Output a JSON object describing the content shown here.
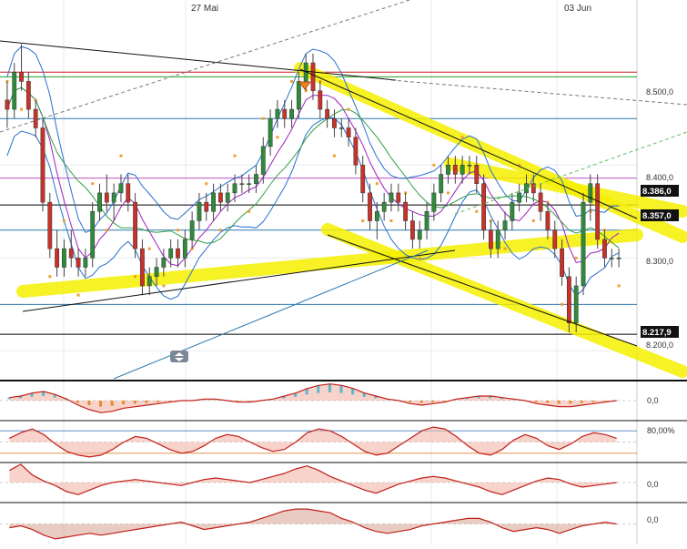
{
  "chart_data": {
    "type": "candlestick",
    "date_labels": [
      "27 Mai",
      "03 Jun"
    ],
    "price_axis": {
      "ylim": [
        8.17,
        8.56
      ],
      "ticks": [
        {
          "value": 8.5,
          "label": "8.500,0"
        },
        {
          "value": 8.4,
          "label": "8.400,0"
        },
        {
          "value": 8.3,
          "label": "8.300,0"
        },
        {
          "value": 8.2,
          "label": "8.200,0"
        }
      ]
    },
    "price_markers": [
      {
        "value": 8.386,
        "label": "8.386,0"
      },
      {
        "value": 8.357,
        "label": "8.357,0"
      },
      {
        "value": 8.2179,
        "label": "8.217,9"
      }
    ],
    "horizontal_levels": [
      {
        "value": 8.5,
        "color": "#d02020"
      },
      {
        "value": 8.495,
        "color": "#20a020"
      },
      {
        "value": 8.45,
        "color": "#2a7ab0"
      },
      {
        "value": 8.386,
        "color": "#c050c0"
      },
      {
        "value": 8.357,
        "color": "#000000"
      },
      {
        "value": 8.33,
        "color": "#2a7ab0"
      },
      {
        "value": 8.25,
        "color": "#2a7ab0"
      },
      {
        "value": 8.2179,
        "color": "#000000"
      }
    ],
    "candles": [
      [
        8.47,
        8.49,
        8.44,
        8.46
      ],
      [
        8.46,
        8.51,
        8.45,
        8.5
      ],
      [
        8.5,
        8.53,
        8.48,
        8.49
      ],
      [
        8.49,
        8.5,
        8.45,
        8.46
      ],
      [
        8.46,
        8.47,
        8.43,
        8.44
      ],
      [
        8.44,
        8.45,
        8.35,
        8.36
      ],
      [
        8.36,
        8.37,
        8.3,
        8.31
      ],
      [
        8.31,
        8.33,
        8.28,
        8.29
      ],
      [
        8.29,
        8.32,
        8.28,
        8.31
      ],
      [
        8.31,
        8.33,
        8.29,
        8.3
      ],
      [
        8.3,
        8.31,
        8.28,
        8.29
      ],
      [
        8.29,
        8.31,
        8.28,
        8.3
      ],
      [
        8.3,
        8.36,
        8.29,
        8.35
      ],
      [
        8.35,
        8.38,
        8.34,
        8.37
      ],
      [
        8.37,
        8.39,
        8.35,
        8.36
      ],
      [
        8.36,
        8.38,
        8.34,
        8.37
      ],
      [
        8.37,
        8.39,
        8.36,
        8.38
      ],
      [
        8.38,
        8.39,
        8.35,
        8.36
      ],
      [
        8.36,
        8.37,
        8.3,
        8.31
      ],
      [
        8.31,
        8.32,
        8.26,
        8.27
      ],
      [
        8.27,
        8.29,
        8.26,
        8.28
      ],
      [
        8.28,
        8.3,
        8.27,
        8.29
      ],
      [
        8.29,
        8.31,
        8.28,
        8.3
      ],
      [
        8.3,
        8.32,
        8.29,
        8.31
      ],
      [
        8.31,
        8.32,
        8.29,
        8.3
      ],
      [
        8.3,
        8.33,
        8.29,
        8.32
      ],
      [
        8.32,
        8.35,
        8.31,
        8.34
      ],
      [
        8.34,
        8.37,
        8.33,
        8.36
      ],
      [
        8.36,
        8.37,
        8.34,
        8.35
      ],
      [
        8.35,
        8.38,
        8.34,
        8.37
      ],
      [
        8.37,
        8.38,
        8.35,
        8.36
      ],
      [
        8.36,
        8.38,
        8.35,
        8.37
      ],
      [
        8.37,
        8.39,
        8.36,
        8.38
      ],
      [
        8.38,
        8.39,
        8.37,
        8.38
      ],
      [
        8.38,
        8.39,
        8.37,
        8.38
      ],
      [
        8.38,
        8.4,
        8.37,
        8.39
      ],
      [
        8.39,
        8.43,
        8.38,
        8.42
      ],
      [
        8.42,
        8.46,
        8.41,
        8.45
      ],
      [
        8.45,
        8.47,
        8.44,
        8.46
      ],
      [
        8.46,
        8.47,
        8.44,
        8.45
      ],
      [
        8.45,
        8.47,
        8.44,
        8.46
      ],
      [
        8.46,
        8.5,
        8.45,
        8.49
      ],
      [
        8.49,
        8.52,
        8.48,
        8.51
      ],
      [
        8.51,
        8.52,
        8.47,
        8.48
      ],
      [
        8.48,
        8.49,
        8.45,
        8.46
      ],
      [
        8.46,
        8.47,
        8.44,
        8.45
      ],
      [
        8.45,
        8.46,
        8.43,
        8.44
      ],
      [
        8.44,
        8.45,
        8.43,
        8.44
      ],
      [
        8.44,
        8.45,
        8.42,
        8.43
      ],
      [
        8.43,
        8.44,
        8.39,
        8.4
      ],
      [
        8.4,
        8.41,
        8.36,
        8.37
      ],
      [
        8.37,
        8.38,
        8.33,
        8.34
      ],
      [
        8.34,
        8.36,
        8.32,
        8.35
      ],
      [
        8.35,
        8.37,
        8.34,
        8.36
      ],
      [
        8.36,
        8.38,
        8.35,
        8.37
      ],
      [
        8.37,
        8.38,
        8.35,
        8.36
      ],
      [
        8.36,
        8.37,
        8.33,
        8.34
      ],
      [
        8.34,
        8.35,
        8.31,
        8.32
      ],
      [
        8.32,
        8.34,
        8.31,
        8.33
      ],
      [
        8.33,
        8.36,
        8.32,
        8.35
      ],
      [
        8.35,
        8.38,
        8.34,
        8.37
      ],
      [
        8.37,
        8.4,
        8.36,
        8.39
      ],
      [
        8.39,
        8.41,
        8.38,
        8.4
      ],
      [
        8.4,
        8.41,
        8.38,
        8.39
      ],
      [
        8.39,
        8.41,
        8.38,
        8.4
      ],
      [
        8.4,
        8.41,
        8.39,
        8.4
      ],
      [
        8.4,
        8.41,
        8.37,
        8.38
      ],
      [
        8.38,
        8.39,
        8.32,
        8.33
      ],
      [
        8.33,
        8.34,
        8.3,
        8.31
      ],
      [
        8.31,
        8.34,
        8.3,
        8.33
      ],
      [
        8.33,
        8.35,
        8.32,
        8.34
      ],
      [
        8.34,
        8.37,
        8.33,
        8.36
      ],
      [
        8.36,
        8.38,
        8.35,
        8.37
      ],
      [
        8.37,
        8.39,
        8.36,
        8.38
      ],
      [
        8.38,
        8.39,
        8.36,
        8.37
      ],
      [
        8.37,
        8.38,
        8.34,
        8.35
      ],
      [
        8.35,
        8.36,
        8.32,
        8.33
      ],
      [
        8.33,
        8.34,
        8.3,
        8.31
      ],
      [
        8.31,
        8.32,
        8.27,
        8.28
      ],
      [
        8.28,
        8.29,
        8.22,
        8.23
      ],
      [
        8.23,
        8.28,
        8.22,
        8.27
      ],
      [
        8.27,
        8.37,
        8.26,
        8.36
      ],
      [
        8.36,
        8.39,
        8.34,
        8.38
      ],
      [
        8.38,
        8.39,
        8.31,
        8.32
      ],
      [
        8.32,
        8.33,
        8.29,
        8.3
      ],
      [
        8.3,
        8.31,
        8.29,
        8.3
      ],
      [
        8.3,
        8.31,
        8.29,
        8.3
      ]
    ],
    "indicator_panels": [
      {
        "tick_label": "0,0",
        "values": [
          0.2,
          0.3,
          0.5,
          0.6,
          0.4,
          0.1,
          -0.3,
          -0.6,
          -0.8,
          -0.7,
          -0.5,
          -0.4,
          -0.3,
          -0.2,
          -0.1,
          0.0,
          0.0,
          0.1,
          0.1,
          0.0,
          -0.1,
          -0.1,
          0.0,
          0.1,
          0.3,
          0.5,
          0.8,
          1.0,
          1.1,
          1.0,
          0.8,
          0.5,
          0.3,
          0.1,
          0.0,
          -0.2,
          -0.3,
          -0.2,
          -0.1,
          0.1,
          0.2,
          0.3,
          0.3,
          0.2,
          0.1,
          0.0,
          -0.2,
          -0.3,
          -0.4,
          -0.4,
          -0.3,
          -0.2,
          -0.1,
          0.0
        ]
      },
      {
        "tick_label": "80,00%",
        "values": [
          60,
          75,
          85,
          70,
          45,
          25,
          15,
          10,
          15,
          30,
          50,
          65,
          60,
          45,
          30,
          20,
          25,
          40,
          60,
          70,
          65,
          50,
          35,
          25,
          30,
          50,
          75,
          85,
          80,
          65,
          45,
          25,
          15,
          20,
          40,
          60,
          80,
          90,
          85,
          65,
          40,
          20,
          15,
          30,
          55,
          70,
          60,
          40,
          30,
          45,
          65,
          75,
          70,
          60
        ]
      },
      {
        "tick_label": "0,0",
        "values": [
          0.8,
          1.2,
          0.5,
          0.1,
          -0.2,
          -0.6,
          -0.8,
          -0.5,
          -0.2,
          0.0,
          0.1,
          0.2,
          0.1,
          0.0,
          -0.1,
          -0.2,
          0.0,
          0.2,
          0.3,
          0.2,
          0.1,
          0.0,
          0.2,
          0.4,
          0.6,
          0.9,
          1.1,
          0.8,
          0.4,
          0.1,
          -0.2,
          -0.5,
          -0.7,
          -0.4,
          -0.1,
          0.1,
          0.3,
          0.4,
          0.3,
          0.1,
          -0.1,
          -0.3,
          -0.6,
          -0.8,
          -0.5,
          -0.2,
          0.1,
          0.3,
          0.2,
          -0.1,
          -0.3,
          -0.2,
          -0.1,
          0.0
        ]
      },
      {
        "tick_label": "0,0",
        "values": [
          -0.2,
          -0.1,
          -0.3,
          -0.6,
          -0.8,
          -0.7,
          -0.6,
          -0.5,
          -0.6,
          -0.5,
          -0.4,
          -0.3,
          -0.2,
          -0.1,
          0.0,
          0.1,
          -0.1,
          -0.3,
          -0.2,
          -0.1,
          0.0,
          0.1,
          0.3,
          0.5,
          0.7,
          0.8,
          0.8,
          0.7,
          0.6,
          0.3,
          0.1,
          -0.2,
          -0.4,
          -0.5,
          -0.4,
          -0.3,
          -0.1,
          0.0,
          0.1,
          0.2,
          0.3,
          0.3,
          0.1,
          -0.2,
          -0.4,
          -0.3,
          -0.2,
          -0.3,
          -0.5,
          -0.3,
          -0.1,
          0.0,
          0.1,
          0.0
        ]
      }
    ],
    "colors": {
      "up": "#2e8b3a",
      "down": "#c8322a",
      "highlight": "#f5f000",
      "marker_fill": "#111111",
      "marker_text": "#ffffff",
      "bands": "#2a6fd0",
      "psar": "#f0a030"
    },
    "navigator_icon": "scroll-handle-icon"
  }
}
